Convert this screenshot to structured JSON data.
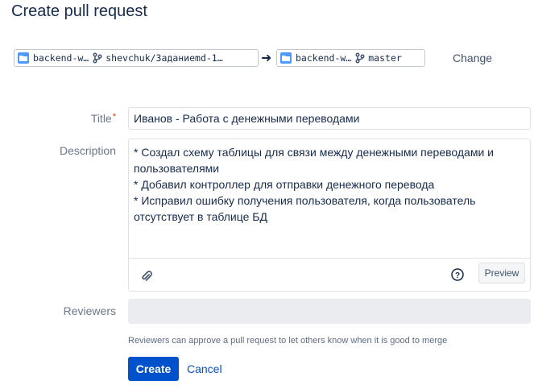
{
  "page": {
    "title": "Create pull request"
  },
  "source": {
    "repo": "backend-w…",
    "branch": "shevchuk/Заданиеmd-1…"
  },
  "target": {
    "repo": "backend-w…",
    "branch": "master"
  },
  "change_label": "Change",
  "form": {
    "title_label": "Title",
    "required_mark": "*",
    "title_value": "Иванов - Работа с денежными переводами",
    "description_label": "Description",
    "description_value": "* Создал схему таблицы для связи между денежными переводами и пользователями\n* Добавил контроллер для отправки денежного перевода\n* Исправил ошибку получения пользователя, когда пользователь отсутствует в таблице БД",
    "preview_label": "Preview",
    "reviewers_label": "Reviewers",
    "reviewers_value": "",
    "reviewers_hint": "Reviewers can approve a pull request to let others know when it is good to merge",
    "create_label": "Create",
    "cancel_label": "Cancel"
  },
  "colors": {
    "primary": "#0052cc",
    "repo_icon": "#4c9aff",
    "required": "#de350b"
  }
}
